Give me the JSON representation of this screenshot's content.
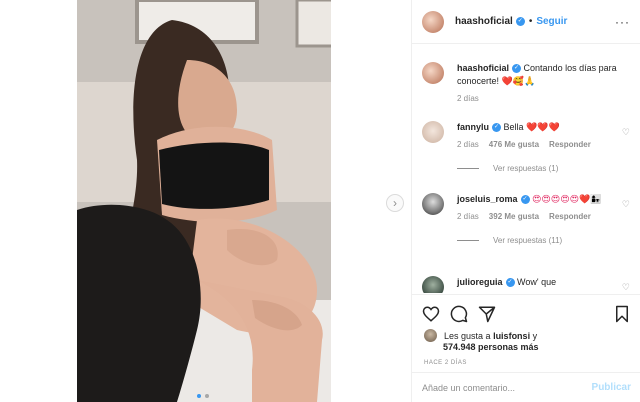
{
  "post": {
    "image_alt": "",
    "carousel": {
      "total": 2,
      "current": 1
    },
    "next_label": "›"
  },
  "header": {
    "username": "haashoficial",
    "separator": "•",
    "follow_label": "Seguir",
    "more_label": "···"
  },
  "caption": {
    "username": "haashoficial",
    "text": "Contando los días para conocerte!",
    "emojis": "❤️🥰🙏",
    "time": "2 días"
  },
  "comments": [
    {
      "username": "fannylu",
      "text": "Bella",
      "emojis": "❤️❤️❤️",
      "time": "2 días",
      "likes": "476 Me gusta",
      "reply_label": "Responder",
      "view_replies": "Ver respuestas (1)"
    },
    {
      "username": "joseluis_roma",
      "text": "",
      "emojis": "😍😍😍😍😍❤️👩‍👧",
      "time": "2 días",
      "likes": "392 Me gusta",
      "reply_label": "Responder",
      "view_replies": "Ver respuestas (11)"
    },
    {
      "username": "julioreguia",
      "text": "Wow' que",
      "emojis": ""
    }
  ],
  "actions": {
    "like_icon": "heart-icon",
    "comment_icon": "comment-icon",
    "share_icon": "share-icon",
    "save_icon": "bookmark-icon"
  },
  "likes": {
    "prefix": "Les gusta a",
    "user": "luisfonsi",
    "suffix": "y",
    "count": "574.948 personas más"
  },
  "time_ago": "HACE 2 DÍAS",
  "add_comment": {
    "placeholder": "Añade un comentario...",
    "publish_label": "Publicar"
  },
  "colors": {
    "accent": "#3897f0",
    "muted": "#8e8e8e",
    "border": "#efefef",
    "publish_disabled": "#b2dffc"
  }
}
